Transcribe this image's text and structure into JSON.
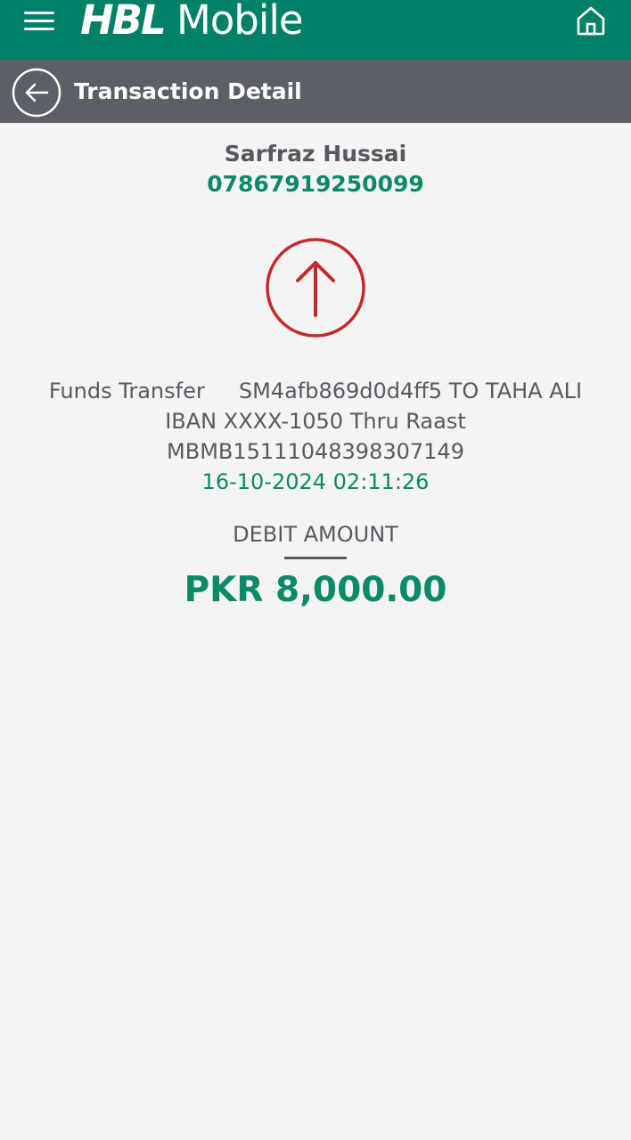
{
  "app": {
    "brand": "HBL",
    "product": "Mobile"
  },
  "header": {
    "menu_icon": "hamburger-menu-icon",
    "home_icon": "home-icon"
  },
  "subheader": {
    "back_icon": "back-arrow-icon",
    "title": "Transaction Detail"
  },
  "transaction": {
    "payee_name": "Sarfraz Hussai",
    "account_number": "07867919250099",
    "direction_icon": "arrow-up-icon",
    "description_lines": [
      "Funds Transfer     SM4afb869d0d4ff5 TO TAHA ALI",
      "IBAN XXXX-1050 Thru Raast",
      "MBMB15111048398307149"
    ],
    "datetime": "16-10-2024 02:11:26",
    "amount_label": "DEBIT AMOUNT",
    "amount": "PKR 8,000.00"
  },
  "colors": {
    "brand_green": "#008066",
    "subheader_gray": "#5b6066",
    "accent_green": "#0a8a69",
    "debit_red": "#c62828",
    "background": "#f4f4f4"
  }
}
